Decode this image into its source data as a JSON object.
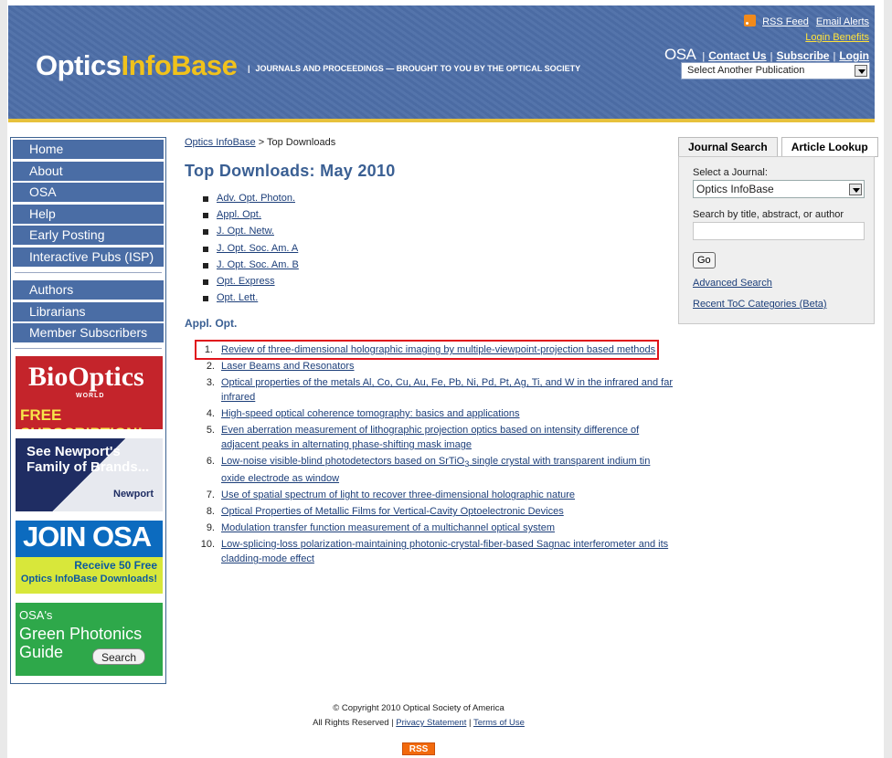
{
  "header": {
    "logo_part1": "Optics",
    "logo_part2": "InfoBase",
    "tagline_bar": "|",
    "tagline": "JOURNALS AND PROCEEDINGS — BROUGHT TO YOU BY THE OPTICAL SOCIETY",
    "rss_feed": "RSS Feed",
    "email_alerts": "Email Alerts",
    "login_benefits": "Login Benefits",
    "osa_mark": "OSA",
    "contact_us": "Contact Us",
    "subscribe": "Subscribe",
    "login": "Login",
    "sep": "|",
    "select_publication": "Select Another Publication"
  },
  "nav": {
    "group1": [
      "Home",
      "About",
      "OSA",
      "Help",
      "Early Posting",
      "Interactive Pubs (ISP)"
    ],
    "group2": [
      "Authors",
      "Librarians",
      "Member Subscribers"
    ]
  },
  "ads": {
    "bioptics_big": "BioOptics",
    "bioptics_sub": "WORLD",
    "bioptics_cta": "FREE SUBSCRIPTION!",
    "newport_text": "See Newport's Family of Brands...",
    "newport_brand": "Newport",
    "joinosa_title": "JOIN OSA",
    "joinosa_l1": "Receive 50 Free",
    "joinosa_l2": "Optics InfoBase Downloads!",
    "green_l1": "OSA's",
    "green_l2": "Green Photonics",
    "green_l3": "Guide",
    "green_search": "Search"
  },
  "breadcrumb": {
    "home": "Optics InfoBase",
    "separator": " > ",
    "current": "Top Downloads"
  },
  "page_title": "Top Downloads: May 2010",
  "journals": [
    "Adv. Opt. Photon.",
    "Appl. Opt.",
    "J. Opt. Netw.",
    "J. Opt. Soc. Am. A",
    "J. Opt. Soc. Am. B",
    "Opt. Express",
    "Opt. Lett."
  ],
  "section_title": "Appl. Opt.",
  "articles": [
    {
      "num": "1.",
      "title": "Review of three-dimensional holographic imaging by multiple-viewpoint-projection based methods"
    },
    {
      "num": "2.",
      "title": "Laser Beams and Resonators"
    },
    {
      "num": "3.",
      "title": "Optical properties of the metals Al, Co, Cu, Au, Fe, Pb, Ni, Pd, Pt, Ag, Ti, and W in the infrared and far infrared"
    },
    {
      "num": "4.",
      "title": "High-speed optical coherence tomography: basics and applications"
    },
    {
      "num": "5.",
      "title": "Even aberration measurement of lithographic projection optics based on intensity difference of adjacent peaks in alternating phase-shifting mask image"
    },
    {
      "num": "6.",
      "title_pre": "Low-noise visible-blind photodetectors based on SrTiO",
      "title_sub": "3",
      "title_post": " single crystal with transparent indium tin oxide electrode as window"
    },
    {
      "num": "7.",
      "title": "Use of spatial spectrum of light to recover three-dimensional holographic nature"
    },
    {
      "num": "8.",
      "title": "Optical Properties of Metallic Films for Vertical-Cavity Optoelectronic Devices"
    },
    {
      "num": "9.",
      "title": "Modulation transfer function measurement of a multichannel optical system"
    },
    {
      "num": "10.",
      "title": "Low-splicing-loss polarization-maintaining photonic-crystal-fiber-based Sagnac interferometer and its cladding-mode effect"
    }
  ],
  "search_panel": {
    "tab_journal": "Journal Search",
    "tab_article": "Article Lookup",
    "select_label": "Select a Journal:",
    "select_value": "Optics InfoBase",
    "search_label": "Search by title, abstract, or author",
    "go": "Go",
    "advanced": "Advanced Search",
    "recent_toc": "Recent ToC Categories (Beta)"
  },
  "footer": {
    "copyright": "© Copyright 2010 Optical Society of America",
    "rights": "All Rights Reserved",
    "sep": "|",
    "privacy": "Privacy Statement",
    "terms": "Terms of Use",
    "rss": "RSS"
  },
  "colors": {
    "header_bg": "#4d6ea8",
    "nav_bg": "#4a6da5",
    "accent_gold": "#e7c13b",
    "highlight_red": "#e0141c",
    "title_blue": "#3a5f93"
  }
}
